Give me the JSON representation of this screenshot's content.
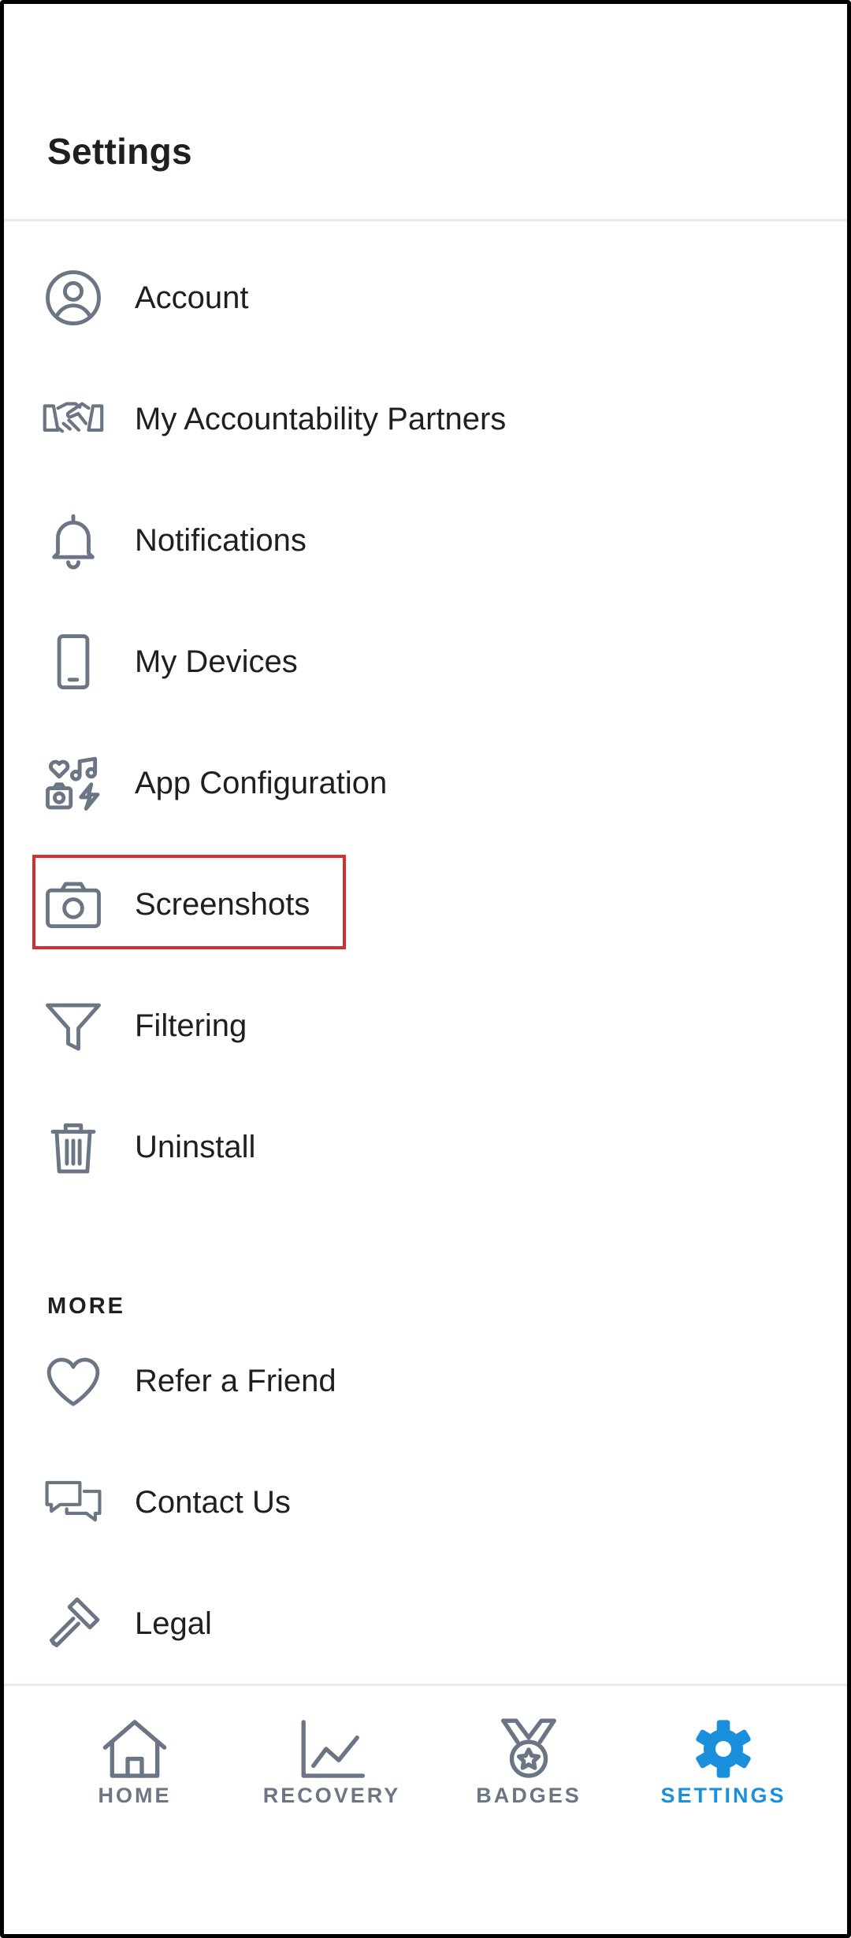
{
  "header": {
    "title": "Settings"
  },
  "menu": {
    "items": [
      {
        "label": "Account",
        "icon": "user-circle-icon"
      },
      {
        "label": "My Accountability Partners",
        "icon": "handshake-icon"
      },
      {
        "label": "Notifications",
        "icon": "bell-icon"
      },
      {
        "label": "My Devices",
        "icon": "phone-icon"
      },
      {
        "label": "App Configuration",
        "icon": "app-config-icon"
      },
      {
        "label": "Screenshots",
        "icon": "camera-icon"
      },
      {
        "label": "Filtering",
        "icon": "filter-icon"
      },
      {
        "label": "Uninstall",
        "icon": "trash-icon"
      }
    ]
  },
  "more": {
    "section_label": "MORE",
    "items": [
      {
        "label": "Refer a Friend",
        "icon": "heart-icon"
      },
      {
        "label": "Contact Us",
        "icon": "chat-bubbles-icon"
      },
      {
        "label": "Legal",
        "icon": "gavel-icon"
      }
    ]
  },
  "bottom_nav": {
    "items": [
      {
        "label": "HOME",
        "icon": "home-icon"
      },
      {
        "label": "RECOVERY",
        "icon": "chart-line-icon"
      },
      {
        "label": "BADGES",
        "icon": "badge-medal-icon"
      },
      {
        "label": "SETTINGS",
        "icon": "gear-icon",
        "active": true
      }
    ]
  },
  "colors": {
    "icon_gray": "#6b7685",
    "active_blue": "#1a8fdc",
    "highlight_red": "#d32f2f",
    "divider": "#e6e9ed"
  }
}
